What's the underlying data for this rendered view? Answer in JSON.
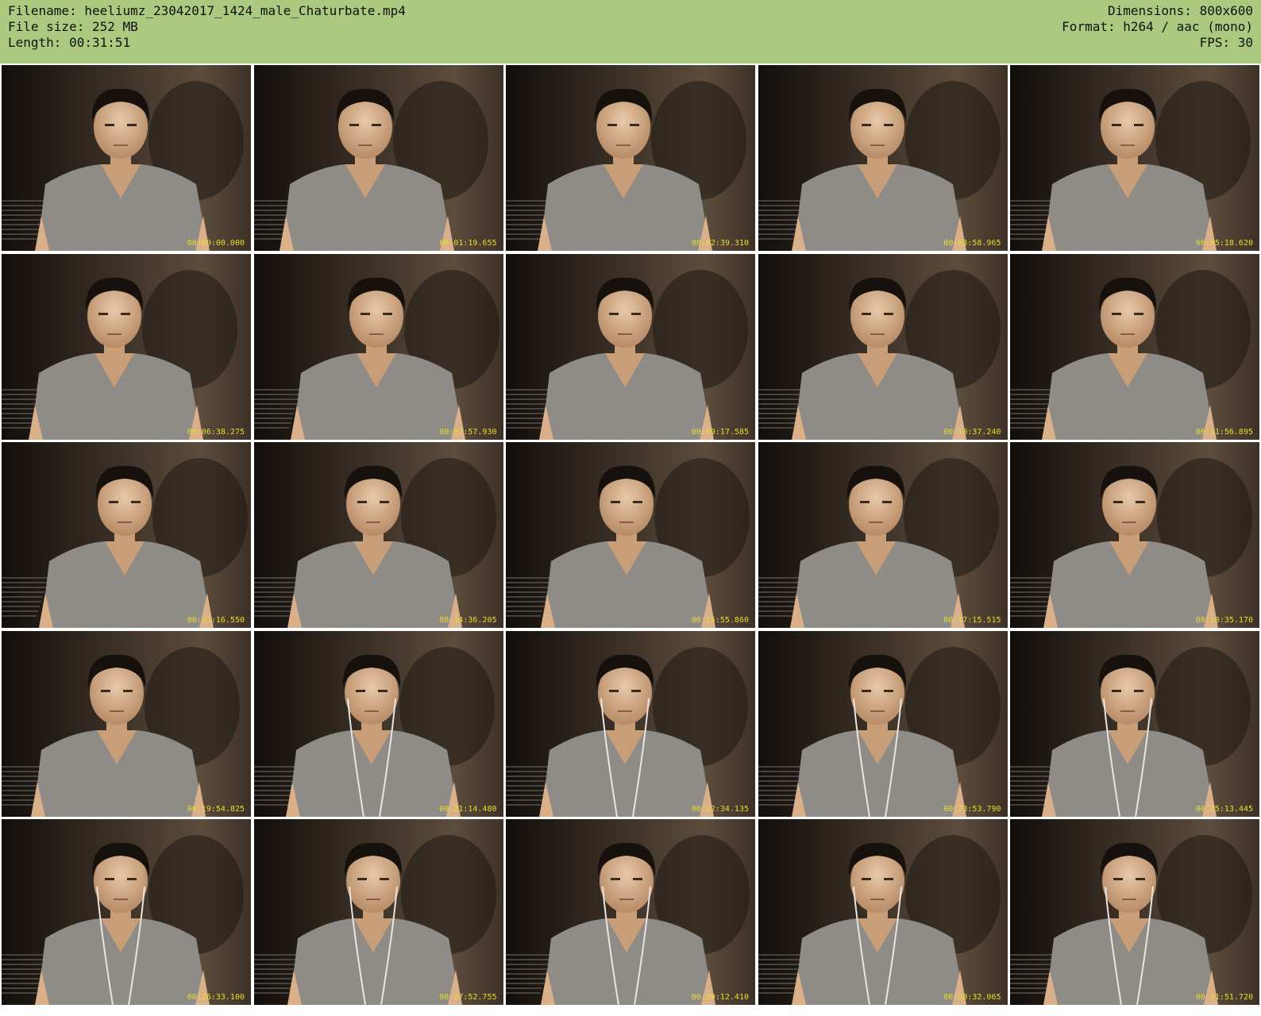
{
  "header": {
    "filename": "Filename: heeliumz_23042017_1424_male_Chaturbate.mp4",
    "filesize": "File size: 252 MB",
    "length": "Length: 00:31:51",
    "dimensions": "Dimensions: 800x600",
    "format": "Format: h264 / aac (mono)",
    "fps": "FPS: 30"
  },
  "colors": {
    "header_bg": "#abc97f",
    "timestamp": "#e7dd2a"
  },
  "thumbnails": [
    {
      "timestamp": "00:00:00.000",
      "earphones": false
    },
    {
      "timestamp": "00:01:19.655",
      "earphones": false
    },
    {
      "timestamp": "00:02:39.310",
      "earphones": false
    },
    {
      "timestamp": "00:03:58.965",
      "earphones": false
    },
    {
      "timestamp": "00:05:18.620",
      "earphones": false
    },
    {
      "timestamp": "00:06:38.275",
      "earphones": false
    },
    {
      "timestamp": "00:07:57.930",
      "earphones": false
    },
    {
      "timestamp": "00:09:17.585",
      "earphones": false
    },
    {
      "timestamp": "00:10:37.240",
      "earphones": false
    },
    {
      "timestamp": "00:11:56.895",
      "earphones": false
    },
    {
      "timestamp": "00:13:16.550",
      "earphones": false
    },
    {
      "timestamp": "00:14:36.205",
      "earphones": false
    },
    {
      "timestamp": "00:15:55.860",
      "earphones": false
    },
    {
      "timestamp": "00:17:15.515",
      "earphones": false
    },
    {
      "timestamp": "00:18:35.170",
      "earphones": false
    },
    {
      "timestamp": "00:19:54.825",
      "earphones": false
    },
    {
      "timestamp": "00:21:14.480",
      "earphones": true
    },
    {
      "timestamp": "00:22:34.135",
      "earphones": true
    },
    {
      "timestamp": "00:23:53.790",
      "earphones": true
    },
    {
      "timestamp": "00:25:13.445",
      "earphones": true
    },
    {
      "timestamp": "00:26:33.100",
      "earphones": true
    },
    {
      "timestamp": "00:27:52.755",
      "earphones": true
    },
    {
      "timestamp": "00:29:12.410",
      "earphones": true
    },
    {
      "timestamp": "00:30:32.065",
      "earphones": true
    },
    {
      "timestamp": "00:31:51.720",
      "earphones": true
    }
  ]
}
